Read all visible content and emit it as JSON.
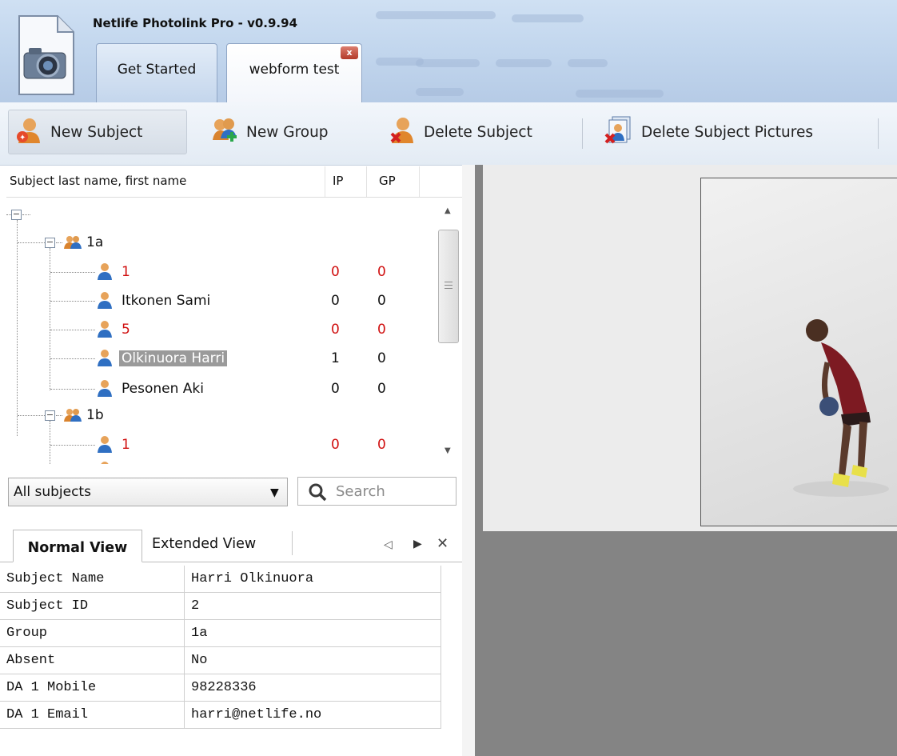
{
  "window": {
    "title": "Netlife Photolink Pro - v0.9.94",
    "tabs": [
      {
        "label": "Get Started"
      },
      {
        "label": "webform test"
      }
    ],
    "tab_close": "x"
  },
  "toolbar": {
    "new_subject": "New Subject",
    "new_group": "New Group",
    "delete_subject": "Delete Subject",
    "delete_subject_pictures": "Delete Subject Pictures"
  },
  "tree": {
    "headers": {
      "name": "Subject last name, first name",
      "ip": "IP",
      "gp": "GP"
    },
    "groups": [
      {
        "label": "1a",
        "subjects": [
          {
            "name": "1",
            "ip": "0",
            "gp": "0",
            "red": true
          },
          {
            "name": "Itkonen Sami",
            "ip": "0",
            "gp": "0",
            "red": false
          },
          {
            "name": "5",
            "ip": "0",
            "gp": "0",
            "red": true
          },
          {
            "name": "Olkinuora Harri",
            "ip": "1",
            "gp": "0",
            "red": false,
            "selected": true
          },
          {
            "name": "Pesonen Aki",
            "ip": "0",
            "gp": "0",
            "red": false
          }
        ]
      },
      {
        "label": "1b",
        "subjects": [
          {
            "name": "1",
            "ip": "0",
            "gp": "0",
            "red": true
          }
        ]
      }
    ]
  },
  "filter": {
    "selected": "All subjects",
    "search_placeholder": "Search"
  },
  "view_tabs": {
    "normal": "Normal View",
    "extended": "Extended View"
  },
  "properties": [
    {
      "key": "Subject Name",
      "value": "Harri Olkinuora"
    },
    {
      "key": "Subject ID",
      "value": "2"
    },
    {
      "key": "Group",
      "value": "1a"
    },
    {
      "key": "Absent",
      "value": "No"
    },
    {
      "key": "DA 1 Mobile",
      "value": "98228336"
    },
    {
      "key": "DA 1 Email",
      "value": "harri@netlife.no"
    }
  ],
  "colors": {
    "accent": "#d01010",
    "titlebar": "#c3d7ee",
    "preview_bg": "#848484"
  }
}
